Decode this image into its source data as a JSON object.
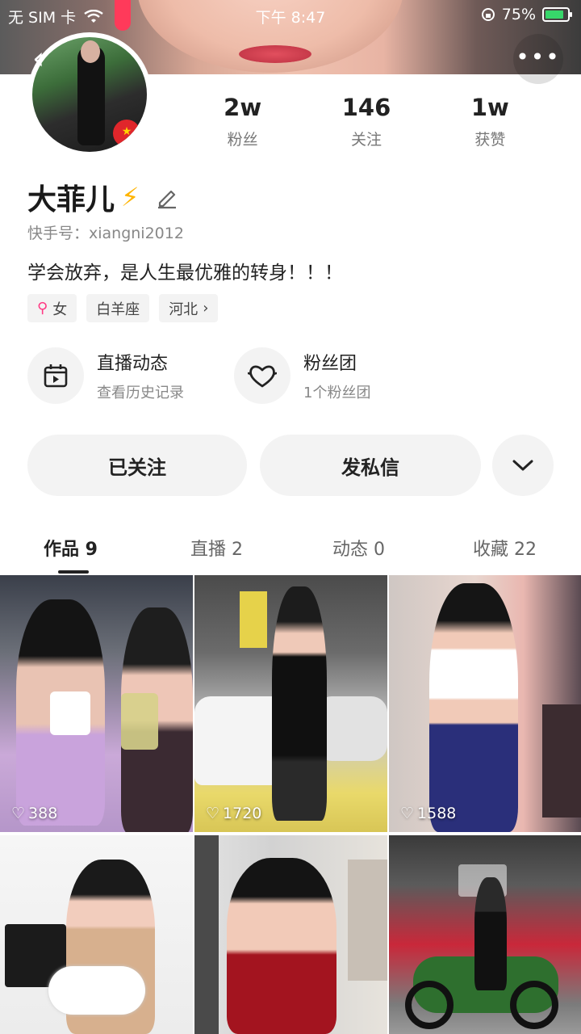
{
  "status_bar": {
    "carrier": "无 SIM 卡",
    "time": "下午 8:47",
    "battery": "75%"
  },
  "profile": {
    "stats": [
      {
        "value": "2w",
        "label": "粉丝"
      },
      {
        "value": "146",
        "label": "关注"
      },
      {
        "value": "1w",
        "label": "获赞"
      }
    ],
    "name": "大菲儿",
    "kuaishou_id": "快手号：xiangni2012",
    "bio": "学会放弃，是人生最优雅的转身！！！",
    "tags": [
      {
        "label": "女",
        "icon": "female-icon"
      },
      {
        "label": "白羊座"
      },
      {
        "label": "河北",
        "icon": "chevron-right-icon"
      }
    ]
  },
  "features": [
    {
      "title": "直播动态",
      "subtitle": "查看历史记录",
      "icon": "live-calendar-icon"
    },
    {
      "title": "粉丝团",
      "subtitle": "1个粉丝团",
      "icon": "fan-heart-icon"
    }
  ],
  "actions": {
    "follow": "已关注",
    "message": "发私信"
  },
  "tabs": [
    {
      "label": "作品 9",
      "active": true
    },
    {
      "label": "直播 2"
    },
    {
      "label": "动态 0"
    },
    {
      "label": "收藏 22"
    }
  ],
  "posts": [
    {
      "likes": "388"
    },
    {
      "likes": "1720"
    },
    {
      "likes": "1588"
    },
    {
      "likes": ""
    },
    {
      "likes": ""
    },
    {
      "likes": ""
    }
  ],
  "colors": {
    "accent_female": "#ff3a84",
    "bolt": "#ffb400",
    "background_button": "#f3f3f3"
  }
}
